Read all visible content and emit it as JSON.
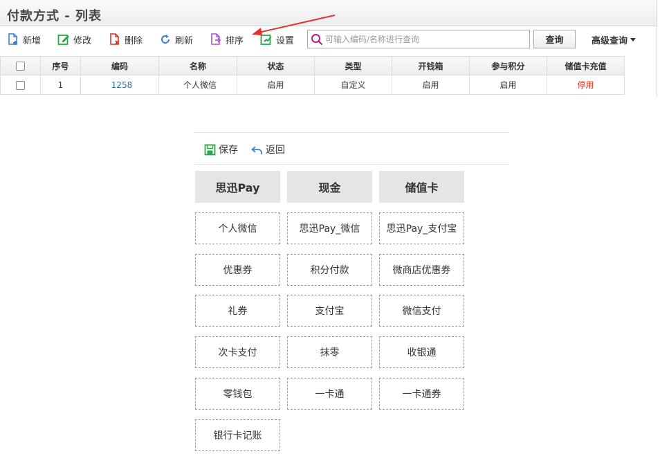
{
  "page": {
    "title": "付款方式 - 列表"
  },
  "toolbar": {
    "add": "新增",
    "edit": "修改",
    "delete": "删除",
    "refresh": "刷新",
    "sort": "排序",
    "settings": "设置",
    "search_placeholder": "可输入编码/名称进行查询",
    "search_value": "",
    "query": "查询",
    "advanced": "高级查询"
  },
  "table": {
    "headers": [
      "序号",
      "编码",
      "名称",
      "状态",
      "类型",
      "开钱箱",
      "参与积分",
      "储值卡充值"
    ],
    "rows": [
      {
        "index": "1",
        "code": "1258",
        "name": "个人微信",
        "status": "启用",
        "type": "自定义",
        "cash_drawer": "启用",
        "points": "启用",
        "stored_value": "停用"
      }
    ]
  },
  "panel": {
    "save": "保存",
    "back": "返回",
    "categories": [
      "思迅Pay",
      "现金",
      "储值卡"
    ],
    "items": [
      "个人微信",
      "思迅Pay_微信",
      "思迅Pay_支付宝",
      "优惠券",
      "积分付款",
      "微商店优惠券",
      "礼券",
      "支付宝",
      "微信支付",
      "次卡支付",
      "抹零",
      "收银通",
      "零钱包",
      "一卡通",
      "一卡通券",
      "银行卡记账"
    ]
  },
  "colors": {
    "link": "#2a6fa8",
    "disabled_red": "#e0281b",
    "arrow_red": "#e8312a",
    "category_bg": "#e5e5e5"
  }
}
